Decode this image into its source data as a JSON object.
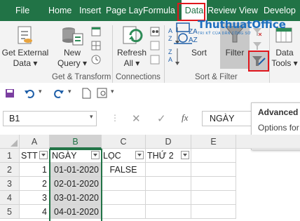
{
  "tabs": [
    "File",
    "Home",
    "Insert",
    "Page Lay",
    "Formula",
    "Data",
    "Review",
    "View",
    "Develop"
  ],
  "watermark": {
    "brand": "ThuthuatOffice",
    "tagline": "TRI KỸ CỦA DÂN CÔNG SỞ"
  },
  "ribbon": {
    "get_external_data": "Get External\nData ▾",
    "new_query": "New\nQuery ▾",
    "refresh_all": "Refresh\nAll ▾",
    "sort": "Sort",
    "filter": "Filter",
    "data_tools": "Data\nTools ▾",
    "groups": {
      "get_transform": "Get & Transform",
      "connections": "Connections",
      "sort_filter": "Sort & Filter"
    }
  },
  "tooltip": {
    "title": "Advanced",
    "body": "Options for\ncriteria."
  },
  "formula_bar": {
    "name_box": "B1",
    "fx": "fx",
    "value": "NGÀY"
  },
  "grid": {
    "columns": [
      "A",
      "B",
      "C",
      "D",
      "E"
    ],
    "rows": [
      "1",
      "2",
      "3",
      "4",
      "5"
    ],
    "header_row": [
      "STT",
      "NGÀY",
      "LỌC",
      "THỨ 2"
    ],
    "data": [
      [
        "1",
        "01-01-2020",
        "FALSE",
        ""
      ],
      [
        "2",
        "02-01-2020",
        "",
        ""
      ],
      [
        "3",
        "03-01-2020",
        "",
        ""
      ],
      [
        "4",
        "04-01-2020",
        "",
        ""
      ]
    ]
  },
  "colors": {
    "excel_green": "#217346",
    "highlight_red": "#e0161c"
  }
}
